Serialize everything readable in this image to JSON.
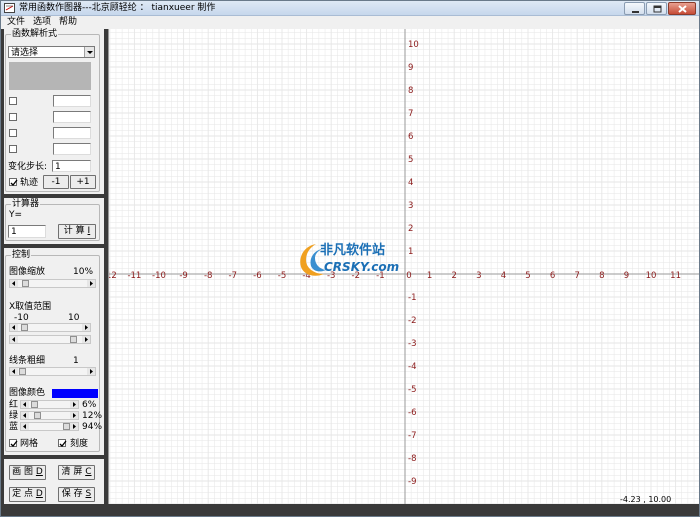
{
  "window": {
    "title": "常用函数作图器---北京顾轻纶 ： tianxueer 制作",
    "icon": "app-icon"
  },
  "menu": [
    "文件",
    "选项",
    "帮助"
  ],
  "function_panel": {
    "title": "函数解析式",
    "combo_value": "请选择",
    "step_label": "变化步长:",
    "step_value": "1",
    "trace_label": "轨迹",
    "trace_checked": true,
    "minus_label": "-1",
    "plus_label": "+1"
  },
  "calculator": {
    "title": "计算器",
    "y_label": "Y=",
    "input_value": "1",
    "calc_label": "计 算",
    "calc_key": "I"
  },
  "control": {
    "title": "控制",
    "zoom_label": "图像缩放",
    "zoom_value": "10%",
    "xrange_label": "X取值范围",
    "xrange_min": "-10",
    "xrange_max": "10",
    "line_label": "线条粗细",
    "line_value": "1",
    "color_label": "图像颜色",
    "color_hex": "#0000ff",
    "red_label": "红",
    "red_value": "6%",
    "green_label": "绿",
    "green_value": "12%",
    "blue_label": "蓝",
    "blue_value": "94%",
    "grid_label": "网格",
    "grid_checked": true,
    "ticks_label": "刻度",
    "ticks_checked": true
  },
  "actions": {
    "draw_label": "画 图",
    "draw_key": "D",
    "clear_label": "清 屏",
    "clear_key": "C",
    "point_label": "定 点",
    "point_key": "D",
    "save_label": "保 存",
    "save_key": "S"
  },
  "plot": {
    "x_ticks": [
      "-12",
      "-11",
      "-10",
      "-9",
      "-8",
      "-7",
      "-6",
      "-5",
      "-4",
      "-3",
      "-2",
      "-1",
      "0",
      "1",
      "2",
      "3",
      "4",
      "5",
      "6",
      "7",
      "8",
      "9",
      "10",
      "11"
    ],
    "y_ticks_pos": [
      "10",
      "9",
      "8",
      "7",
      "6",
      "5",
      "4",
      "3",
      "2",
      "1"
    ],
    "y_ticks_neg": [
      "-1",
      "-2",
      "-3",
      "-4",
      "-5",
      "-6",
      "-7",
      "-8",
      "-9"
    ],
    "grid_color": "#e6e6e6",
    "axis_color": "#9a9a9a",
    "label_color": "#8b1a1a"
  },
  "coord_readout": "-4.23 , 10.00",
  "watermark": {
    "big": "非凡软件站",
    "small": "CRSKY.com"
  }
}
